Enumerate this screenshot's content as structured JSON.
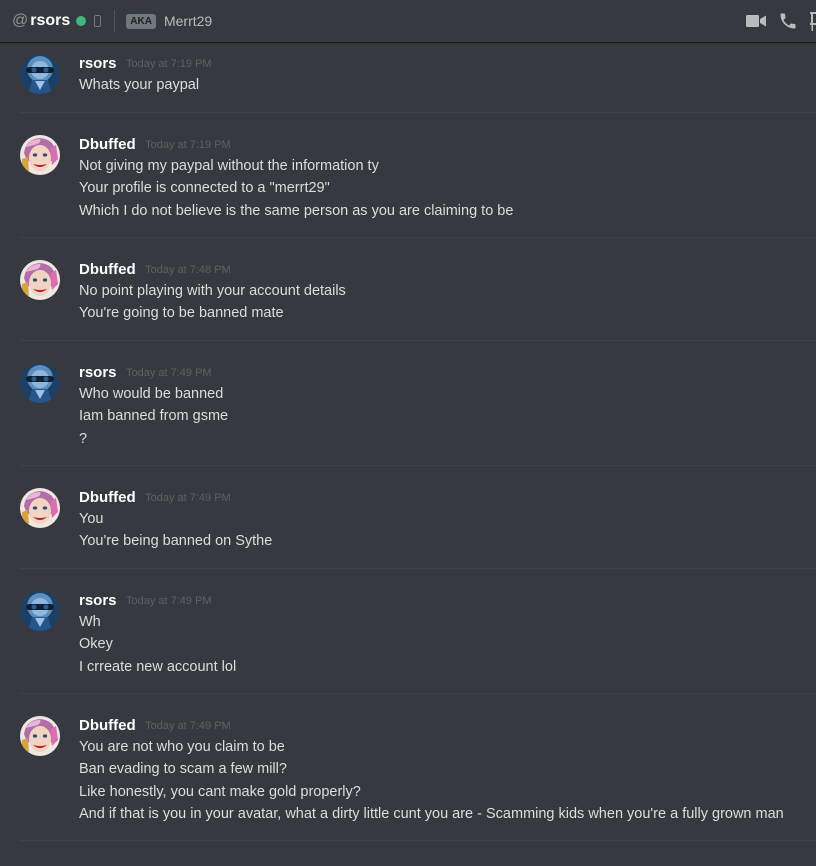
{
  "header": {
    "at": "@",
    "username": "rsors",
    "status_color": "#43b581",
    "aka_badge": "AKA",
    "aka_name": "Merrt29",
    "icons": [
      "video-call-icon",
      "voice-call-icon",
      "pin-icon"
    ]
  },
  "messages": [
    {
      "author": "rsors",
      "time": "Today at 7:19 PM",
      "lines": [
        "Whats your paypal"
      ]
    },
    {
      "author": "Dbuffed",
      "time": "Today at 7:19 PM",
      "lines": [
        "Not giving my paypal without the information ty",
        "Your profile is connected to a \"merrt29\"",
        "Which I do not believe is the same person as you are claiming to be"
      ]
    },
    {
      "author": "Dbuffed",
      "time": "Today at 7:48 PM",
      "lines": [
        "No point playing with your account details",
        "You're going to be banned mate"
      ]
    },
    {
      "author": "rsors",
      "time": "Today at 7:49 PM",
      "lines": [
        "Who would be banned",
        "Iam banned from gsme",
        "?"
      ]
    },
    {
      "author": "Dbuffed",
      "time": "Today at 7:49 PM",
      "lines": [
        "You",
        "You're being banned on Sythe"
      ]
    },
    {
      "author": "rsors",
      "time": "Today at 7:49 PM",
      "lines": [
        "Wh",
        "Okey",
        "I crreate new account lol"
      ]
    },
    {
      "author": "Dbuffed",
      "time": "Today at 7:49 PM",
      "lines": [
        "You are not who you claim to be",
        "Ban evading to scam a few mill?",
        "Like honestly, you cant make gold properly?",
        "And if that is you in your avatar, what a dirty little cunt you are - Scamming kids when you're a fully grown man"
      ]
    }
  ]
}
